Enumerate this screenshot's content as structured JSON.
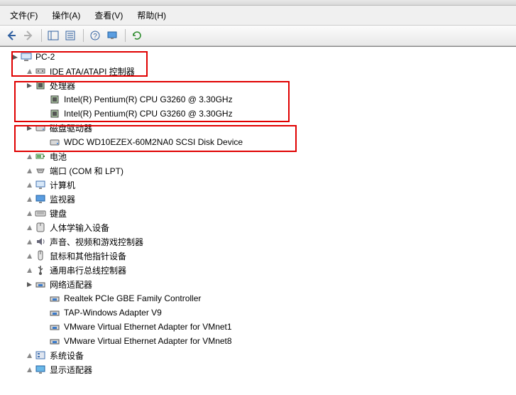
{
  "menu": {
    "file": "文件(F)",
    "action": "操作(A)",
    "view": "查看(V)",
    "help": "帮助(H)"
  },
  "root": "PC-2",
  "nodes": {
    "ide": "IDE ATA/ATAPI 控制器",
    "cpu": "处理器",
    "cpu1": "Intel(R) Pentium(R) CPU G3260 @ 3.30GHz",
    "cpu2": "Intel(R) Pentium(R) CPU G3260 @ 3.30GHz",
    "disk": "磁盘驱动器",
    "disk1": "WDC WD10EZEX-60M2NA0 SCSI Disk Device",
    "battery": "电池",
    "ports": "端口 (COM 和 LPT)",
    "computer": "计算机",
    "monitor": "监视器",
    "keyboard": "键盘",
    "hid": "人体学输入设备",
    "sound": "声音、视频和游戏控制器",
    "mouse": "鼠标和其他指针设备",
    "usb": "通用串行总线控制器",
    "net": "网络适配器",
    "net1": "Realtek PCIe GBE Family Controller",
    "net2": "TAP-Windows Adapter V9",
    "net3": "VMware Virtual Ethernet Adapter for VMnet1",
    "net4": "VMware Virtual Ethernet Adapter for VMnet8",
    "system": "系统设备",
    "display": "显示适配器"
  }
}
